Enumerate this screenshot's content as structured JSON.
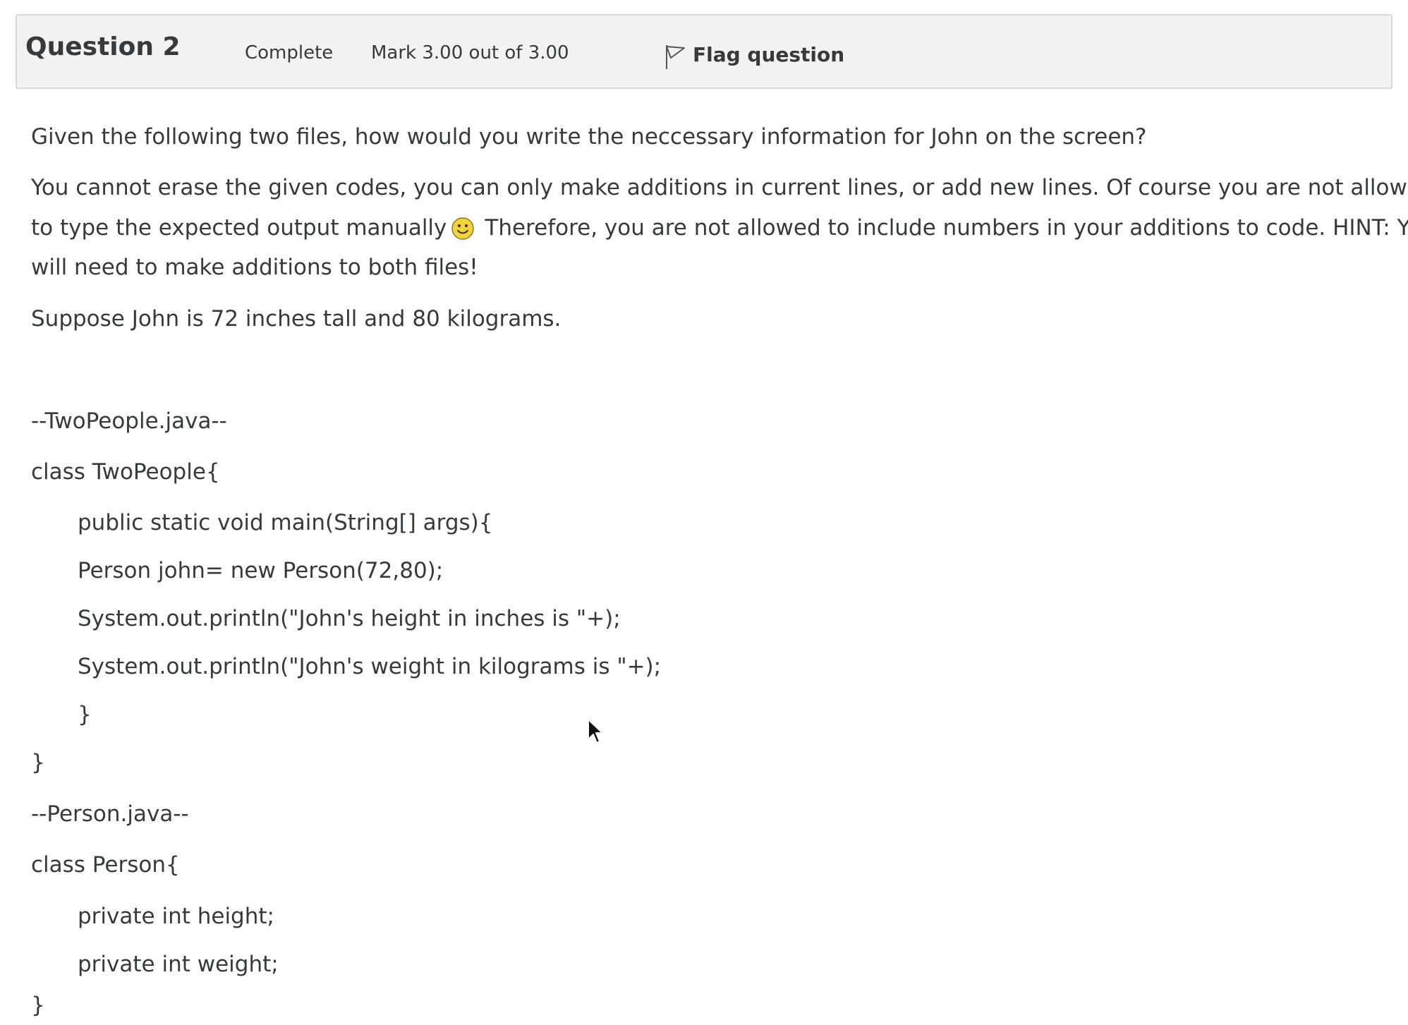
{
  "question": {
    "title": "Question 2",
    "state": "Complete",
    "grade": "Mark 3.00 out of 3.00",
    "flag_label": "Flag question"
  },
  "text": {
    "p1": "Given the following two files, how would you write the neccessary information for John on the screen?",
    "p2_line1": "You cannot erase the given codes, you can only make additions in current lines, or add new lines. Of course you are not allowed",
    "p2_line2_a": "to type the expected output manually",
    "p2_line2_b": "Therefore, you are not allowed to include numbers in your additions to code. HINT: You",
    "p2_line3": "will need to make additions to both files!",
    "p3": "Suppose John is 72 inches tall and 80 kilograms."
  },
  "code": {
    "file1_name": "--TwoPeople.java--",
    "file1_lines": [
      "class TwoPeople{",
      "public static void main(String[] args){",
      "Person john= new Person(72,80);",
      "System.out.println(\"John's height in inches is \"+);",
      "System.out.println(\"John's weight in kilograms is \"+);",
      "}",
      "}"
    ],
    "file2_name": "--Person.java--",
    "file2_lines": [
      "class Person{",
      "private int height;",
      "private int weight;",
      "}"
    ]
  },
  "icons": {
    "flag": "flag-outline-icon",
    "emoji": "smiley-emoji-icon",
    "cursor": "mouse-pointer-icon"
  },
  "colors": {
    "header_bg": "#f2f2f2",
    "header_border": "#d9d9d9",
    "text": "#373a3c",
    "emoji_yellow": "#f5d33b"
  }
}
